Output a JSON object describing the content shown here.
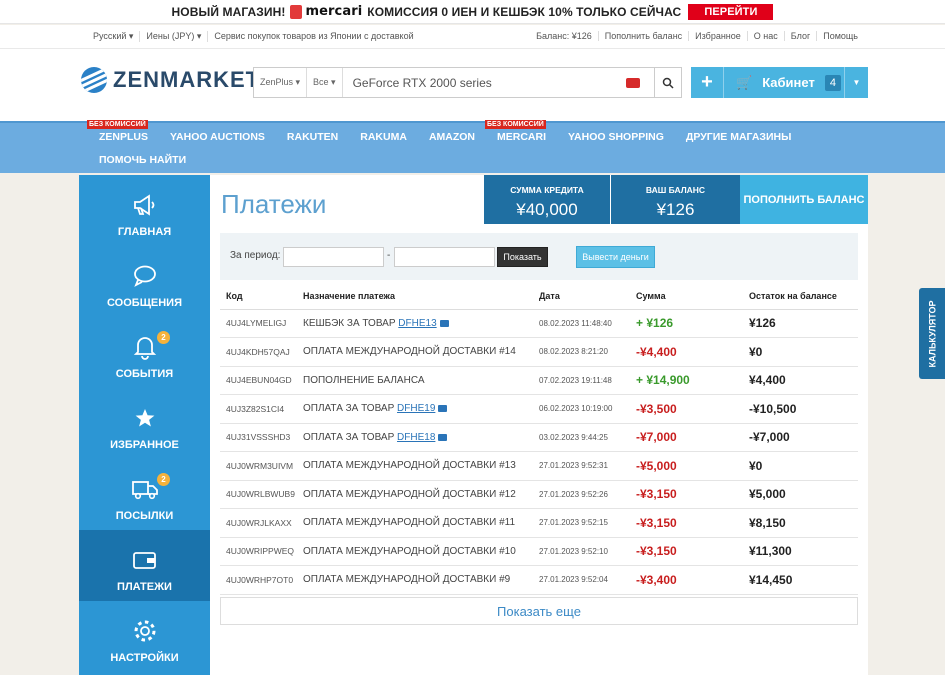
{
  "promo": {
    "text1": "НОВЫЙ МАГАЗИН!",
    "brand": "mercari",
    "text2": "КОМИССИЯ 0 ИЕН И КЕШБЭК 10% ТОЛЬКО СЕЙЧАС",
    "button": "ПЕРЕЙТИ",
    "accent": "#e00019"
  },
  "topbar": {
    "language": "Русский ▾",
    "currency": "Иены (JPY) ▾",
    "tagline": "Сервис покупок товаров из Японии с доставкой",
    "links": [
      "Баланс: ¥126",
      "Пополнить баланс",
      "Избранное",
      "О нас",
      "Блог",
      "Помощь"
    ]
  },
  "header": {
    "logo": "ZENMARKET",
    "search_scope": "ZenPlus ▾",
    "search_category": "Все ▾",
    "search_value": "GeForce RTX 2000 series",
    "cabinet_label": "Кабинет",
    "cabinet_count": "4"
  },
  "nav": {
    "items": [
      "ZENPLUS",
      "YAHOO AUCTIONS",
      "RAKUTEN",
      "RAKUMA",
      "AMAZON",
      "MERCARI",
      "YAHOO SHOPPING",
      "ДРУГИЕ МАГАЗИНЫ"
    ],
    "tag": "БЕЗ КОМИССИЙ",
    "help": "ПОМОЧЬ НАЙТИ"
  },
  "sidebar": {
    "items": [
      {
        "label": "ГЛАВНАЯ",
        "icon": "megaphone-icon"
      },
      {
        "label": "СООБЩЕНИЯ",
        "icon": "chat-icon"
      },
      {
        "label": "СОБЫТИЯ",
        "icon": "bell-icon",
        "badge": "2"
      },
      {
        "label": "ИЗБРАННОЕ",
        "icon": "star-icon"
      },
      {
        "label": "ПОСЫЛКИ",
        "icon": "truck-icon",
        "badge": "2"
      },
      {
        "label": "ПЛАТЕЖИ",
        "icon": "wallet-icon"
      },
      {
        "label": "НАСТРОЙКИ",
        "icon": "gear-icon"
      }
    ]
  },
  "page": {
    "title": "Платежи",
    "credit_label": "СУММА КРЕДИТА",
    "credit_value": "¥40,000",
    "balance_label": "ВАШ БАЛАНС",
    "balance_value": "¥126",
    "topup": "ПОПОЛНИТЬ БАЛАНС"
  },
  "filter": {
    "period_label": "За период:",
    "dash": "-",
    "show": "Показать",
    "withdraw": "Вывести деньги"
  },
  "table": {
    "headers": [
      "Код",
      "Назначение платежа",
      "Дата",
      "Сумма",
      "Остаток на балансе"
    ],
    "rows": [
      {
        "code": "4UJ4LYMELIGJ",
        "purpose": "КЕШБЭК ЗА ТОВАР",
        "ref": "DFHE13",
        "date": "08.02.2023 11:48:40",
        "amount": "+ ¥126",
        "sign": "pos",
        "balance": "¥126"
      },
      {
        "code": "4UJ4KDH57QAJ",
        "purpose": "ОПЛАТА МЕЖДУНАРОДНОЙ ДОСТАВКИ #14",
        "ref": "",
        "date": "08.02.2023 8:21:20",
        "amount": "-¥4,400",
        "sign": "neg",
        "balance": "¥0"
      },
      {
        "code": "4UJ4EBUN04GD",
        "purpose": "ПОПОЛНЕНИЕ БАЛАНСА",
        "ref": "",
        "date": "07.02.2023 19:11:48",
        "amount": "+ ¥14,900",
        "sign": "pos",
        "balance": "¥4,400"
      },
      {
        "code": "4UJ3Z82S1CI4",
        "purpose": "ОПЛАТА ЗА ТОВАР",
        "ref": "DFHE19",
        "date": "06.02.2023 10:19:00",
        "amount": "-¥3,500",
        "sign": "neg",
        "balance": "-¥10,500"
      },
      {
        "code": "4UJ31VSSSHD3",
        "purpose": "ОПЛАТА ЗА ТОВАР",
        "ref": "DFHE18",
        "date": "03.02.2023 9:44:25",
        "amount": "-¥7,000",
        "sign": "neg",
        "balance": "-¥7,000"
      },
      {
        "code": "4UJ0WRM3UIVM",
        "purpose": "ОПЛАТА МЕЖДУНАРОДНОЙ ДОСТАВКИ #13",
        "ref": "",
        "date": "27.01.2023 9:52:31",
        "amount": "-¥5,000",
        "sign": "neg",
        "balance": "¥0"
      },
      {
        "code": "4UJ0WRLBWUB9",
        "purpose": "ОПЛАТА МЕЖДУНАРОДНОЙ ДОСТАВКИ #12",
        "ref": "",
        "date": "27.01.2023 9:52:26",
        "amount": "-¥3,150",
        "sign": "neg",
        "balance": "¥5,000"
      },
      {
        "code": "4UJ0WRJLKAXX",
        "purpose": "ОПЛАТА МЕЖДУНАРОДНОЙ ДОСТАВКИ #11",
        "ref": "",
        "date": "27.01.2023 9:52:15",
        "amount": "-¥3,150",
        "sign": "neg",
        "balance": "¥8,150"
      },
      {
        "code": "4UJ0WRIPPWEQ",
        "purpose": "ОПЛАТА МЕЖДУНАРОДНОЙ ДОСТАВКИ #10",
        "ref": "",
        "date": "27.01.2023 9:52:10",
        "amount": "-¥3,150",
        "sign": "neg",
        "balance": "¥11,300"
      },
      {
        "code": "4UJ0WRHP7OT0",
        "purpose": "ОПЛАТА МЕЖДУНАРОДНОЙ ДОСТАВКИ #9",
        "ref": "",
        "date": "27.01.2023 9:52:04",
        "amount": "-¥3,400",
        "sign": "neg",
        "balance": "¥14,450"
      }
    ],
    "more": "Показать еще"
  },
  "calculator": "КАЛЬКУЛЯТОР"
}
